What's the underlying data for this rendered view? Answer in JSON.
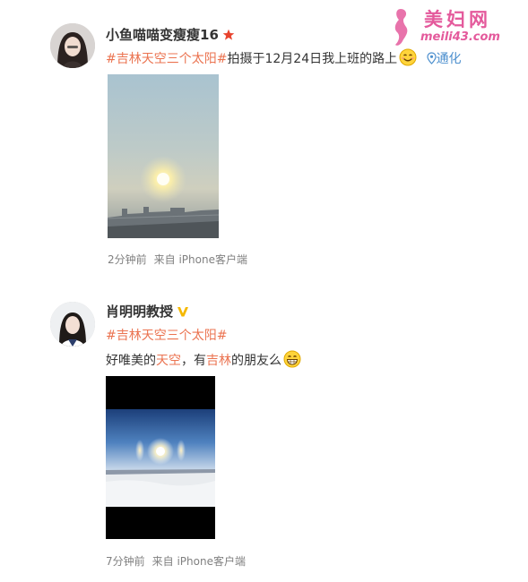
{
  "watermark": {
    "title": "美妇网",
    "url": "meili43.com"
  },
  "posts": [
    {
      "username": "小鱼喵喵变瘦瘦16",
      "hashtag": "#吉林天空三个太阳#",
      "text": "拍摄于12月24日我上班的路上",
      "location": "通化",
      "time": "2分钟前",
      "source": "来自 iPhone客户端"
    },
    {
      "username": "肖明明教授",
      "hashtag": "#吉林天空三个太阳#",
      "text_parts": [
        "好唯美的",
        "天空",
        "，有",
        "吉林",
        "的朋友么"
      ],
      "time": "7分钟前",
      "source": "来自 iPhone客户端"
    }
  ],
  "colors": {
    "hashtag": "#eb7350",
    "location": "#4c8fce",
    "meta": "#808080",
    "star_badge": "#e8432e",
    "v_badge": "#f5b800",
    "watermark": "#e45a9c"
  }
}
